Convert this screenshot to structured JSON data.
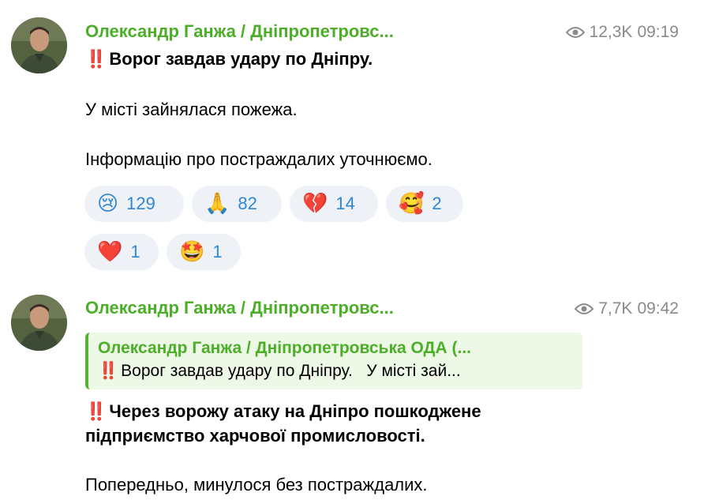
{
  "posts": [
    {
      "author": "Олександр Ганжа / Дніпропетровс...",
      "views": "12,3K",
      "time": "09:19",
      "headline_marker": "‼️",
      "headline": "Ворог завдав удару по Дніпру.",
      "paragraph1": "У місті зайнялася пожежа.",
      "paragraph2": "Інформацію про постраждалих уточнюємо.",
      "reactions": [
        {
          "emoji": "😢",
          "icon": "crying-face-icon",
          "count": "129"
        },
        {
          "emoji": "🙏",
          "icon": "folded-hands-icon",
          "count": "82"
        },
        {
          "emoji": "💔",
          "icon": "broken-heart-icon",
          "count": "14"
        },
        {
          "emoji": "🥰",
          "icon": "smiling-face-with-hearts-icon",
          "count": "2"
        },
        {
          "emoji": "❤️",
          "icon": "red-heart-icon",
          "count": "1"
        },
        {
          "emoji": "🤩",
          "icon": "star-struck-icon",
          "count": "1"
        }
      ]
    },
    {
      "author": "Олександр Ганжа / Дніпропетровс...",
      "views": "7,7K",
      "time": "09:42",
      "quote": {
        "title": "Олександр Ганжа / Дніпропетровська ОДА (...",
        "marker": "‼️",
        "text": "Ворог завдав удару по Дніпру.   У місті зай..."
      },
      "headline_marker": "‼️",
      "headline_line1": "Через ворожу атаку на Дніпро пошкоджене",
      "headline_line2": "підприємство харчової промисловості.",
      "paragraph1": "Попередньо, минулося без постраждалих."
    }
  ],
  "colors": {
    "author": "#4caf28",
    "meta": "#8a8a8e",
    "reaction_bg": "#eef2f7",
    "reaction_count": "#2d86d6",
    "quote_bg": "#eef8e7",
    "quote_bar": "#55b233"
  }
}
